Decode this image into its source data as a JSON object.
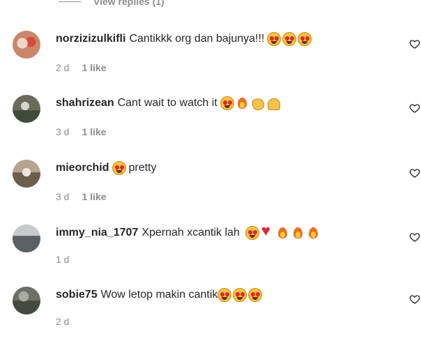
{
  "view_replies": "View replies (1)",
  "comments": [
    {
      "username": "norzizizulkifli",
      "text": "Cantikkk org dan bajunya!!!",
      "emojis": [
        "heart-eyes",
        "heart-eyes",
        "heart-eyes"
      ],
      "time": "2 d",
      "likes": "1 like",
      "avatar_color": "#c9866a"
    },
    {
      "username": "shahrizean",
      "text": "Cant wait to watch it",
      "emojis": [
        "heart-eyes",
        "fire",
        "clap",
        "hands"
      ],
      "time": "3 d",
      "likes": "1 like",
      "avatar_color": "#6b6b5a"
    },
    {
      "username": "mieorchid",
      "text": "pretty",
      "emojis_before": [
        "heart-eyes"
      ],
      "time": "3 d",
      "likes": "1 like",
      "avatar_color": "#9a8a78"
    },
    {
      "username": "immy_nia_1707",
      "text": "Xpernah xcantik lah",
      "emojis": [
        "heart-eyes",
        "heart",
        "fire",
        "fire",
        "fire"
      ],
      "time": "1 d",
      "likes": "",
      "avatar_color": "#8d8f93"
    },
    {
      "username": "sobie75",
      "text": "Wow letop makin cantik",
      "emojis": [
        "heart-eyes",
        "heart-eyes",
        "heart-eyes"
      ],
      "time": "2 d",
      "likes": "",
      "avatar_color": "#6c6f66"
    }
  ]
}
